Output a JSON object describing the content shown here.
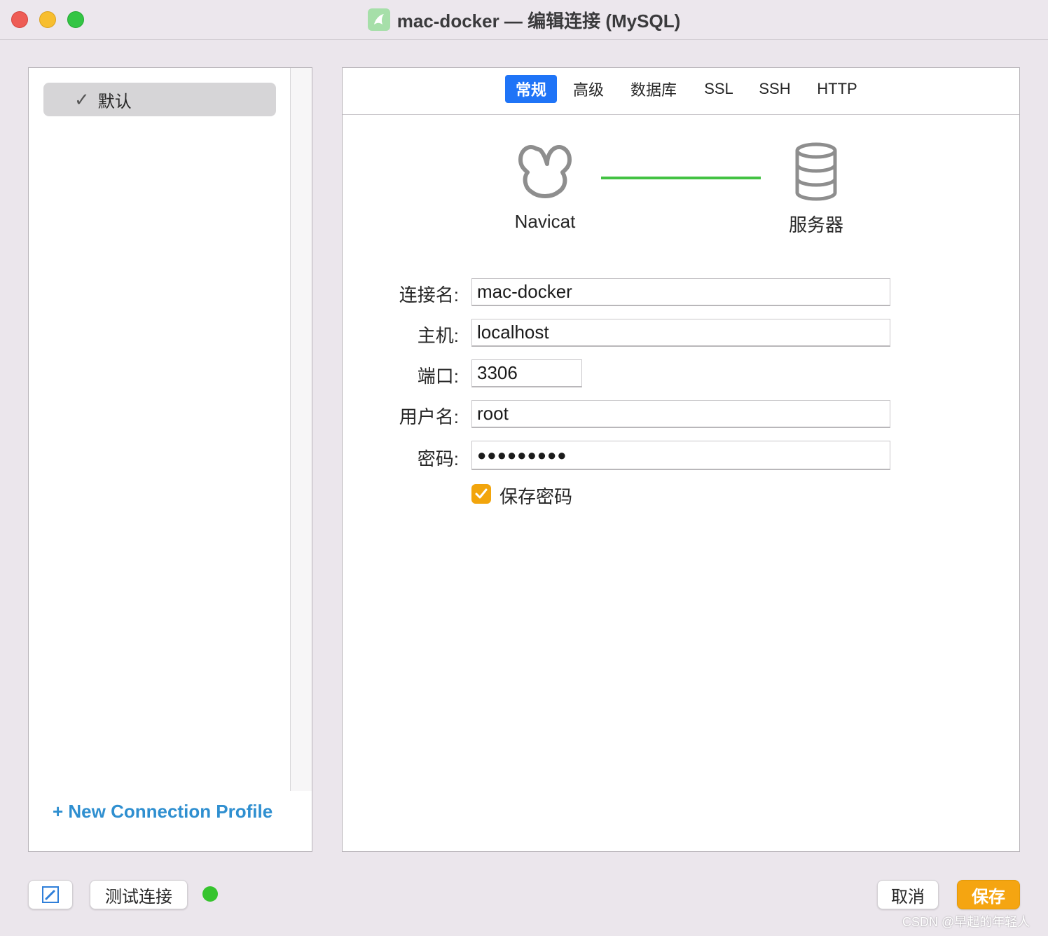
{
  "window": {
    "title": "mac-docker — 编辑连接 (MySQL)",
    "app_icon": "navicat-dolphin-icon"
  },
  "sidebar": {
    "profiles": [
      {
        "label": "默认",
        "selected": true
      }
    ],
    "new_profile_label": "+ New Connection Profile"
  },
  "tabs": [
    {
      "label": "常规",
      "active": true
    },
    {
      "label": "高级",
      "active": false
    },
    {
      "label": "数据库",
      "active": false
    },
    {
      "label": "SSL",
      "active": false
    },
    {
      "label": "SSH",
      "active": false
    },
    {
      "label": "HTTP",
      "active": false
    }
  ],
  "diagram": {
    "client_label": "Navicat",
    "server_label": "服务器",
    "link_color": "#43c243"
  },
  "form": {
    "connection_name": {
      "label": "连接名:",
      "value": "mac-docker"
    },
    "host": {
      "label": "主机:",
      "value": "localhost"
    },
    "port": {
      "label": "端口:",
      "value": "3306"
    },
    "username": {
      "label": "用户名:",
      "value": "root"
    },
    "password": {
      "label": "密码:",
      "value": "●●●●●●●●●"
    },
    "save_password": {
      "label": "保存密码",
      "checked": true
    }
  },
  "footer": {
    "test_connection_label": "测试连接",
    "status_color": "#36c42e",
    "cancel_label": "取消",
    "save_label": "保存",
    "watermark": "CSDN @早起的年轻人"
  },
  "colors": {
    "accent_tab": "#1f74f7",
    "primary_button": "#f5a511",
    "link_text": "#2f8fd0"
  }
}
